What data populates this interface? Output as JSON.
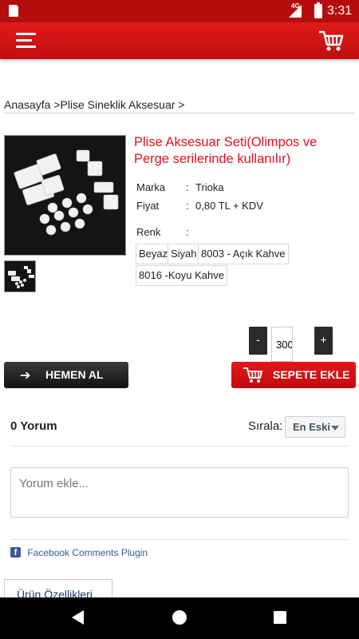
{
  "status_bar": {
    "time": "3:31",
    "network": "4G",
    "icons": [
      "sd-card-icon",
      "signal-icon",
      "battery-icon"
    ]
  },
  "app_bar": {
    "menu_icon": "hamburger-menu-icon",
    "cart_icon": "shopping-cart-icon",
    "color": "#d8141a"
  },
  "breadcrumb": "Anasayfa >Plise Sineklik Aksesuar >",
  "product": {
    "title": "Plise Aksesuar Seti(Olimpos ve Perge serilerinde kullanılır)",
    "brand_label": "Marka",
    "brand_sep": ":",
    "brand_value": "Trioka",
    "price_label": "Fiyat",
    "price_sep": ":",
    "price_value": "0,80 TL + KDV",
    "color_label": "Renk",
    "color_sep": ":",
    "color_options": [
      "Beyaz",
      "Siyah",
      "8003 - Açık Kahve",
      "8016 -Koyu Kahve"
    ],
    "title_color": "#e8101c"
  },
  "quantity": {
    "minus": "-",
    "plus": "+",
    "value": "300"
  },
  "actions": {
    "buy_now": "HEMEN AL",
    "buy_now_icon": "arrow-right-icon",
    "add_to_cart": "SEPETE EKLE",
    "add_to_cart_icon": "shopping-cart-icon"
  },
  "comments": {
    "count_label": "0 Yorum",
    "sort_label": "Sırala:",
    "sort_value": "En Eski",
    "placeholder": "Yorum ekle...",
    "plugin_label": "Facebook Comments Plugin"
  },
  "tabs": {
    "product_props": "Ürün Özellikleri"
  },
  "nav_bar": {
    "icons": [
      "back-icon",
      "home-icon",
      "recent-apps-icon"
    ]
  }
}
